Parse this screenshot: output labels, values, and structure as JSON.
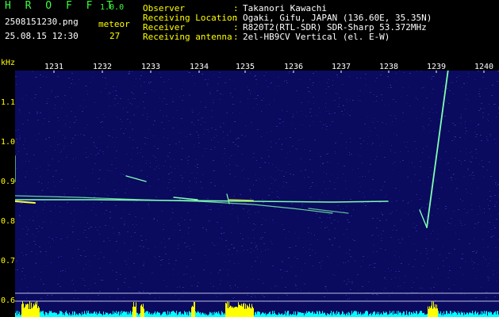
{
  "header": {
    "app_title": "H R O F F T",
    "app_version": "1.0.0",
    "file_name": "2508151230.png",
    "timestamp": "25.08.15 12:30",
    "meteor_label": "meteor",
    "meteor_count": "27"
  },
  "station_info": [
    {
      "label": "Observer",
      "separator": ":",
      "value": "Takanori Kawachi"
    },
    {
      "label": "Receiving Location",
      "separator": ":",
      "value": "Ogaki, Gifu, JAPAN (136.60E, 35.35N)"
    },
    {
      "label": "Receiver",
      "separator": ":",
      "value": "R820T2(RTL-SDR) SDR-Sharp 53.372MHz"
    },
    {
      "label": "Receiving antenna",
      "separator": ":",
      "value": "2el-HB9CV Vertical (el. E-W)"
    }
  ],
  "chart_data": {
    "type": "heatmap",
    "y_unit_label": "kHz",
    "x_ticks": [
      "1231",
      "1232",
      "1233",
      "1234",
      "1235",
      "1236",
      "1237",
      "1238",
      "1239",
      "1240"
    ],
    "y_ticks": [
      "1.1",
      "1.0",
      "0.9",
      "0.8",
      "0.7",
      "0.6"
    ],
    "colors": {
      "background": "#0a0a5e",
      "noise": "#2a3aa8",
      "echo": "#7fffb0",
      "echo_strong": "#ffff40",
      "activity_bar": "#00ffff",
      "activity_peak": "#ffff00",
      "axis_text": "#ffff00",
      "header_accent": "#3cff3c"
    }
  }
}
